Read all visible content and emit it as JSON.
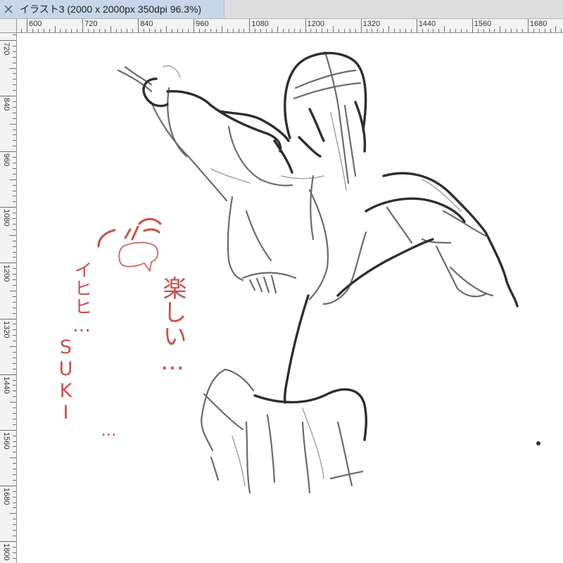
{
  "window": {
    "tab_title": "イラスト3 (2000 x 2000px 350dpi 96.3%)"
  },
  "icons": {
    "close": "close-icon"
  },
  "rulers": {
    "horizontal": [
      "600",
      "720",
      "840",
      "960",
      "1080",
      "1200",
      "1320",
      "1440",
      "1560",
      "1680"
    ],
    "vertical": [
      "720",
      "840",
      "960",
      "1080",
      "1200",
      "1320",
      "1440",
      "1560",
      "1680",
      "1800"
    ]
  },
  "canvas": {
    "annotations": [
      "イヒヒ…",
      "SUKI",
      "…",
      "楽しい…"
    ]
  },
  "colors": {
    "tab_active": "#c7d6ea",
    "tab_bar": "#dedede",
    "ruler_bg": "#f3f3f3",
    "canvas_bg": "#ffffff",
    "sketch_dark": "#2e2e2e",
    "sketch_mid": "#6b6b6b",
    "sketch_light": "#a8a8a8",
    "annotation_red": "#c9504a"
  }
}
